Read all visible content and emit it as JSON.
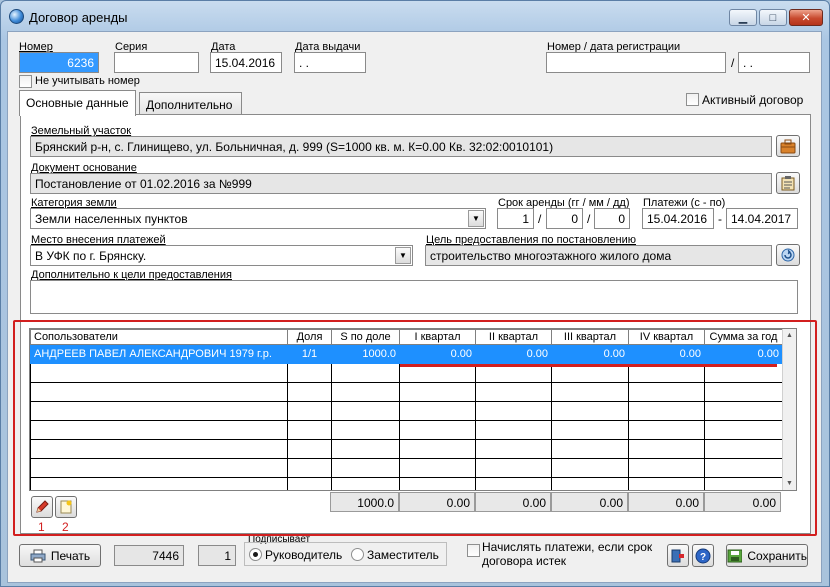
{
  "window": {
    "title": "Договор аренды",
    "controls": {
      "minimize": "▁",
      "maximize": "□",
      "close": "✕"
    }
  },
  "header": {
    "number_label": "Номер",
    "number_value": "6236",
    "series_label": "Серия",
    "series_value": "",
    "date_label": "Дата",
    "date_value": "15.04.2016",
    "issue_date_label": "Дата выдачи",
    "issue_date_value": " .  .",
    "reg_label": "Номер / дата регистрации",
    "reg_number_value": "",
    "reg_separator": "/",
    "reg_date_value": " .  .",
    "ignore_number_label": "Не учитывать номер",
    "active_contract_label": "Активный договор"
  },
  "tabs": [
    {
      "label": "Основные данные",
      "active": true
    },
    {
      "label": "Дополнительно",
      "active": false
    }
  ],
  "main": {
    "land_plot_label": "Земельный участок",
    "land_plot_value": "Брянский р-н, с. Глинищево, ул. Больничная, д. 999 (S=1000 кв. м. К=0.00 Кв. 32:02:0010101)",
    "basis_doc_label": "Документ основание",
    "basis_doc_value": "Постановление от 01.02.2016 за №999",
    "land_category_label": "Категория земли",
    "land_category_value": "Земли населенных пунктов",
    "lease_term_label": "Срок аренды (гг / мм / дд)",
    "lease_years": "1",
    "lease_months": "0",
    "lease_days": "0",
    "term_sep": "/",
    "payments_label": "Платежи  (с - по)",
    "payments_from": "15.04.2016",
    "payments_dash": "-",
    "payments_to": "14.04.2017",
    "payment_place_label": "Место внесения платежей",
    "payment_place_value": "В УФК по г. Брянску.",
    "purpose_label": "Цель предоставления по постановлению",
    "purpose_value": "строительство многоэтажного жилого дома",
    "extra_purpose_label": "Дополнительно к цели предоставления",
    "extra_purpose_value": ""
  },
  "grid": {
    "columns": [
      "Сопользователи",
      "Доля",
      "S по доле",
      "I квартал",
      "II квартал",
      "III квартал",
      "IV квартал",
      "Сумма за год"
    ],
    "rows": [
      [
        "АНДРЕЕВ ПАВЕЛ АЛЕКСАНДРОВИЧ 1979 г.р.",
        "1/1",
        "1000.0",
        "0.00",
        "0.00",
        "0.00",
        "0.00",
        "0.00"
      ]
    ],
    "totals": [
      "1000.0",
      "0.00",
      "0.00",
      "0.00",
      "0.00",
      "0.00"
    ],
    "annotations": [
      "1",
      "2"
    ]
  },
  "footer": {
    "print_label": "Печать",
    "counter_value": "7446",
    "copies_value": "1",
    "signer_label": "Подписывает",
    "signer_options": [
      "Руководитель",
      "Заместитель"
    ],
    "accrue_label_line1": "Начислять платежи, если срок",
    "accrue_label_line2": "договора истек",
    "save_label": "Сохранить"
  },
  "icons": {
    "edit": "pencil-icon",
    "new": "new-document-icon",
    "help": "help-icon",
    "exit": "exit-icon",
    "save": "save-icon"
  }
}
